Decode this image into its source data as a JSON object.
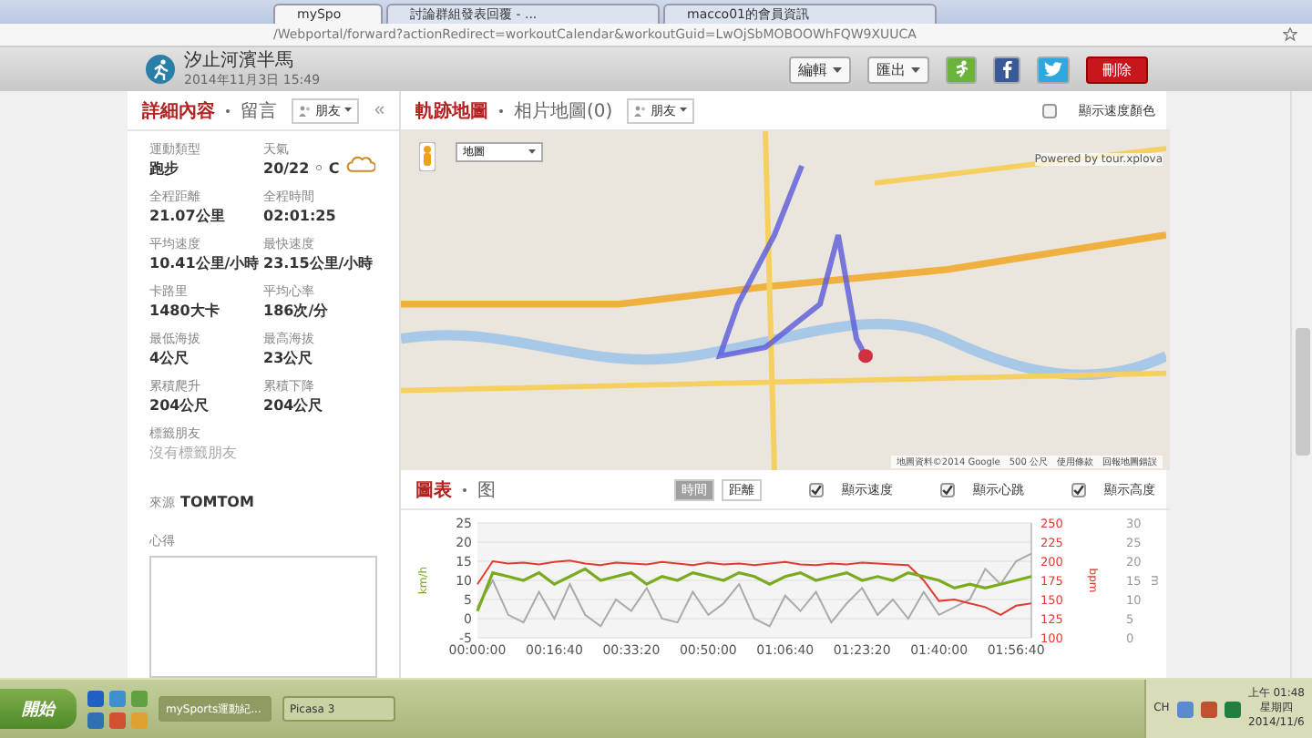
{
  "browser": {
    "tabs": [
      {
        "label": "mySpo",
        "selected": true
      },
      {
        "label": "討論群組發表回覆 - ...",
        "selected": false
      },
      {
        "label": "macco01的會員資訊",
        "selected": false
      }
    ],
    "address": "/Webportal/forward?actionRedirect=workoutCalendar&workoutGuid=LwOjSbMOBOOWhFQW9XUUCA"
  },
  "header": {
    "title": "汐止河濱半馬",
    "date": "2014年11月3日 15:49",
    "buttons": [
      {
        "kind": "dropdown",
        "label": "編輯"
      },
      {
        "kind": "dropdown",
        "label": "匯出"
      },
      {
        "kind": "icon-green"
      },
      {
        "kind": "icon-facebook"
      },
      {
        "kind": "icon-twitter"
      },
      {
        "kind": "danger",
        "label": "刪除"
      }
    ]
  },
  "details": {
    "tabs": [
      {
        "label": "詳細內容",
        "selected": true
      },
      {
        "label": "留言",
        "selected": false
      }
    ],
    "filter": "朋友",
    "collapse": "«",
    "stats": [
      {
        "label": "運動類型",
        "value": "跑步"
      },
      {
        "label": "天氣",
        "value": "20/22 ◦ C",
        "kind": "weather"
      },
      {
        "label": "全程距離",
        "value": "21.07公里"
      },
      {
        "label": "全程時間",
        "value": "02:01:25"
      },
      {
        "label": "平均速度",
        "value": "10.41公里/小時"
      },
      {
        "label": "最快速度",
        "value": "23.15公里/小時"
      },
      {
        "label": "卡路里",
        "value": "1480大卡"
      },
      {
        "label": "平均心率",
        "value": "186次/分"
      },
      {
        "label": "最低海拔",
        "value": "4公尺"
      },
      {
        "label": "最高海拔",
        "value": "23公尺"
      },
      {
        "label": "累積爬升",
        "value": "204公尺"
      },
      {
        "label": "累積下降",
        "value": "204公尺"
      }
    ],
    "tagged_label": "標籤朋友",
    "tagged_value": "沒有標籤朋友",
    "source_label": "來源",
    "source_value": "TOMTOM",
    "notes_label": "心得"
  },
  "map": {
    "tabs": [
      {
        "label": "軌跡地圖",
        "selected": true
      },
      {
        "label": "相片地圖(0)",
        "selected": false
      }
    ],
    "filter": "朋友",
    "speed_color": {
      "label": "顯示速度顏色",
      "checked": false
    },
    "map_type": "地圖",
    "powered": "Powered by tour.xplova",
    "attribution": [
      "地圖資料©2014 Google",
      "500 公尺",
      "使用條款",
      "回報地圖錯誤"
    ]
  },
  "chart": {
    "tabs": [
      {
        "label": "圖表",
        "selected": true
      },
      {
        "label": "图",
        "selected": false
      }
    ],
    "toggle": [
      {
        "label": "時間",
        "selected": true
      },
      {
        "label": "距離",
        "selected": false
      }
    ],
    "options": [
      {
        "label": "顯示速度",
        "checked": true
      },
      {
        "label": "顯示心跳",
        "checked": true
      },
      {
        "label": "顯示高度",
        "checked": true
      }
    ],
    "chart_data": {
      "type": "line",
      "ylabel": "km/h",
      "x": [
        0,
        200,
        400,
        600,
        800,
        1000,
        1200,
        1400,
        1600,
        1800,
        2000,
        2200,
        2400,
        2600,
        2800,
        3000,
        3200,
        3400,
        3600,
        3800,
        4000,
        4200,
        4400,
        4600,
        4800,
        5000,
        5200,
        5400,
        5600,
        5800,
        6000,
        6200,
        6400,
        6600,
        6800,
        7000,
        7200
      ],
      "xlim": [
        0,
        7200
      ],
      "ylim": [
        -5,
        25
      ],
      "xticks": [
        {
          "value": 0,
          "label": "00:00:00"
        },
        {
          "value": 1000,
          "label": "00:16:40"
        },
        {
          "value": 2000,
          "label": "00:33:20"
        },
        {
          "value": 3000,
          "label": "00:50:00"
        },
        {
          "value": 4000,
          "label": "01:06:40"
        },
        {
          "value": 5000,
          "label": "01:23:20"
        },
        {
          "value": 6000,
          "label": "01:40:00"
        },
        {
          "value": 7000,
          "label": "01:56:40"
        }
      ],
      "yticks": [
        -5,
        0,
        5,
        10,
        15,
        20,
        25
      ],
      "grid": true,
      "y2label": "bpm",
      "y2lim": [
        100,
        250
      ],
      "y2ticks": [
        100,
        125,
        150,
        175,
        200,
        225,
        250
      ],
      "y3label": "m",
      "y3lim": [
        0,
        30
      ],
      "y3ticks": [
        0,
        5,
        10,
        15,
        20,
        25,
        30
      ],
      "series": [
        {
          "color": "#aaaaaa",
          "axis": "y3",
          "values": [
            8,
            15,
            6,
            4,
            12,
            5,
            14,
            6,
            3,
            10,
            7,
            13,
            5,
            4,
            12,
            6,
            9,
            14,
            5,
            3,
            11,
            7,
            12,
            4,
            9,
            13,
            6,
            10,
            5,
            12,
            6,
            8,
            10,
            18,
            14,
            20,
            22
          ]
        },
        {
          "color": "#e03c31",
          "axis": "y2",
          "values": [
            170,
            200,
            197,
            198,
            196,
            199,
            201,
            197,
            195,
            198,
            197,
            196,
            199,
            197,
            195,
            198,
            196,
            197,
            195,
            197,
            199,
            196,
            195,
            197,
            196,
            198,
            197,
            196,
            195,
            175,
            148,
            150,
            145,
            140,
            130,
            142,
            145
          ]
        },
        {
          "color": "#7aab1e",
          "values": [
            2,
            12,
            11,
            10,
            12,
            9,
            11,
            13,
            10,
            11,
            12,
            9,
            11,
            10,
            12,
            11,
            10,
            12,
            11,
            9,
            11,
            12,
            10,
            11,
            12,
            10,
            11,
            10,
            12,
            11,
            10,
            8,
            9,
            8,
            9,
            10,
            11
          ]
        }
      ]
    }
  },
  "taskbar": {
    "start": "開始",
    "tasks": [
      {
        "label": "mySports運動紀...",
        "selected": true
      },
      {
        "label": "Picasa 3",
        "selected": false
      }
    ],
    "lang": "CH",
    "time": "上午 01:48",
    "weekday": "星期四",
    "date": "2014/11/6"
  }
}
